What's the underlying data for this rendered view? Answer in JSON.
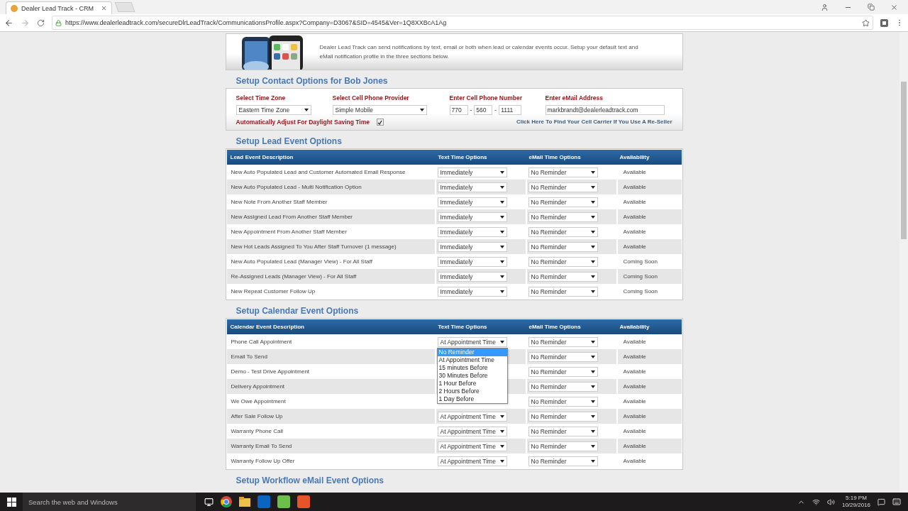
{
  "browser": {
    "tab_title": "Dealer Lead Track - CRM",
    "url": "https://www.dealerleadtrack.com/secureDlrLeadTrack/CommunicationsProfile.aspx?Company=D3067&SID=4545&Ver=1Q8XXBcA1Ag"
  },
  "intro": {
    "text": "Dealer Lead Track can send notifications by text, email or both when lead or calendar events occur. Setup your default text and eMail notification profile in the three sections below."
  },
  "contact": {
    "heading": "Setup Contact Options for Bob Jones",
    "time_zone": {
      "label": "Select Time Zone",
      "value": "Eastern Time Zone"
    },
    "provider": {
      "label": "Select Cell Phone Provider",
      "value": "Simple Mobile"
    },
    "phone": {
      "label": "Enter Cell Phone Number",
      "parts": [
        "770",
        "560",
        "1111"
      ],
      "separator": "-"
    },
    "email": {
      "label": "Enter eMail Address",
      "value": "markbrandt@dealerleadtrack.com"
    },
    "daylight": {
      "label": "Automatically Adjust For Daylight Saving Time",
      "checked": true
    },
    "carrier_link": "Click Here To Find Your Cell Carrier If You Use A Re-Seller"
  },
  "lead_events": {
    "heading": "Setup Lead Event Options",
    "columns": [
      "Lead Event Description",
      "Text Time Options",
      "eMail Time Options",
      "Availability"
    ],
    "rows": [
      {
        "description": "New Auto Populated Lead and Customer Automated Email Response",
        "text_option": "Immediately",
        "email_option": "No Reminder",
        "availability": "Available"
      },
      {
        "description": "New Auto Populated Lead - Multi Notification Option",
        "text_option": "Immediately",
        "email_option": "No Reminder",
        "availability": "Available"
      },
      {
        "description": "New Note From Another Staff Member",
        "text_option": "Immediately",
        "email_option": "No Reminder",
        "availability": "Available"
      },
      {
        "description": "New Assigned Lead From Another Staff Member",
        "text_option": "Immediately",
        "email_option": "No Reminder",
        "availability": "Available"
      },
      {
        "description": "New Appointment From Another Staff Member",
        "text_option": "Immediately",
        "email_option": "No Reminder",
        "availability": "Available"
      },
      {
        "description": "New Hot Leads Assigned To You After Staff Turnover (1 message)",
        "text_option": "Immediately",
        "email_option": "No Reminder",
        "availability": "Available"
      },
      {
        "description": "New Auto Populated Lead (Manager View) - For All Staff",
        "text_option": "Immediately",
        "email_option": "No Reminder",
        "availability": "Coming Soon"
      },
      {
        "description": "Re-Assigned Leads (Manager View) - For All Staff",
        "text_option": "Immediately",
        "email_option": "No Reminder",
        "availability": "Coming Soon"
      },
      {
        "description": "New Repeat Customer Follow Up",
        "text_option": "Immediately",
        "email_option": "No Reminder",
        "availability": "Coming Soon"
      }
    ]
  },
  "calendar_events": {
    "heading": "Setup Calendar Event Options",
    "columns": [
      "Calendar Event Description",
      "Text Time Options",
      "eMail Time Options",
      "Availability"
    ],
    "rows": [
      {
        "description": "Phone Call Appointment",
        "text_option": "At Appointment Time",
        "email_option": "No Reminder",
        "availability": "Available",
        "dropdown": [
          {
            "label": "No Reminder",
            "selected": true
          },
          {
            "label": "At Appointment Time",
            "selected": false
          },
          {
            "label": "15 minutes Before",
            "selected": false
          },
          {
            "label": "30 Minutes Before",
            "selected": false
          },
          {
            "label": "1 Hour Before",
            "selected": false
          },
          {
            "label": "2 Hours Before",
            "selected": false
          },
          {
            "label": "1 Day Before",
            "selected": false
          }
        ]
      },
      {
        "description": "Email To Send",
        "email_option": "No Reminder",
        "availability": "Available"
      },
      {
        "description": "Demo - Test Drive Appointment",
        "email_option": "No Reminder",
        "availability": "Available"
      },
      {
        "description": "Delivery Appointment",
        "email_option": "No Reminder",
        "availability": "Available"
      },
      {
        "description": "We Owe Appointment",
        "email_option": "No Reminder",
        "availability": "Available"
      },
      {
        "description": "After Sale Follow Up",
        "text_option": "At Appointment Time",
        "email_option": "No Reminder",
        "availability": "Available"
      },
      {
        "description": "Warranty Phone Call",
        "text_option": "At Appointment Time",
        "email_option": "No Reminder",
        "availability": "Available"
      },
      {
        "description": "Warranty Email To Send",
        "text_option": "At Appointment Time",
        "email_option": "No Reminder",
        "availability": "Available"
      },
      {
        "description": "Warranty Follow Up Offer",
        "text_option": "At Appointment Time",
        "email_option": "No Reminder",
        "availability": "Available"
      }
    ]
  },
  "workflow_heading": "Setup Workflow eMail Event Options",
  "taskbar": {
    "search_placeholder": "Search the web and Windows",
    "time": "5:19 PM",
    "date": "10/29/2016"
  }
}
